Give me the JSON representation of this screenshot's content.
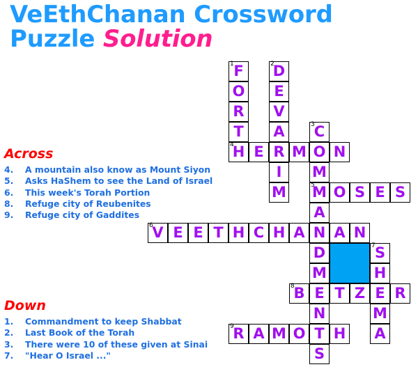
{
  "title": {
    "line1": "VeEthChanan Crossword",
    "line2_main": "Puzzle ",
    "line2_emph": "Solution",
    "color_main": "#1f9bff",
    "color_emph": "#ff1e8e"
  },
  "across": {
    "heading": "Across",
    "heading_color": "#ff0000",
    "clues": [
      {
        "num": "4.",
        "text": "A mountain also know as Mount Siyon"
      },
      {
        "num": "5.",
        "text": "Asks HaShem to see the Land of Israel"
      },
      {
        "num": "6.",
        "text": "This week's Torah Portion"
      },
      {
        "num": "8.",
        "text": "Refuge city of Reubenites"
      },
      {
        "num": "9.",
        "text": "Refuge city of Gaddites"
      }
    ]
  },
  "down": {
    "heading": "Down",
    "heading_color": "#ff0000",
    "clues": [
      {
        "num": "1.",
        "text": "Commandment to keep Shabbat"
      },
      {
        "num": "2.",
        "text": "Last Book of the Torah"
      },
      {
        "num": "3.",
        "text": "There were 10 of these given at Sinai"
      },
      {
        "num": "7.",
        "text": "\"Hear O Israel ...\""
      }
    ]
  },
  "grid": {
    "cell_size": 29,
    "letter_color": "#a110ee",
    "block_color": "#00a2f3",
    "answers": {
      "down_1": "FORTH",
      "down_2": "DEVARIM",
      "down_3": "COMMANDMENTS",
      "down_7": "SHEMA",
      "across_4": "HERMON",
      "across_5": "MOSES",
      "across_6": "VEETHCHANAN",
      "across_8": "BETZER",
      "across_9": "RAMOTH"
    },
    "cells": [
      {
        "r": 0,
        "c": 4,
        "l": "F",
        "n": "1"
      },
      {
        "r": 1,
        "c": 4,
        "l": "O"
      },
      {
        "r": 2,
        "c": 4,
        "l": "R"
      },
      {
        "r": 3,
        "c": 4,
        "l": "T"
      },
      {
        "r": 0,
        "c": 6,
        "l": "D",
        "n": "2"
      },
      {
        "r": 1,
        "c": 6,
        "l": "E"
      },
      {
        "r": 2,
        "c": 6,
        "l": "V"
      },
      {
        "r": 3,
        "c": 6,
        "l": "A"
      },
      {
        "r": 3,
        "c": 8,
        "l": "C",
        "n": "3"
      },
      {
        "r": 4,
        "c": 4,
        "l": "H",
        "n": "4"
      },
      {
        "r": 4,
        "c": 5,
        "l": "E"
      },
      {
        "r": 4,
        "c": 6,
        "l": "R"
      },
      {
        "r": 4,
        "c": 7,
        "l": "M"
      },
      {
        "r": 4,
        "c": 8,
        "l": "O"
      },
      {
        "r": 4,
        "c": 9,
        "l": "N"
      },
      {
        "r": 5,
        "c": 6,
        "l": "I"
      },
      {
        "r": 5,
        "c": 8,
        "l": "M"
      },
      {
        "r": 6,
        "c": 6,
        "l": "M"
      },
      {
        "r": 6,
        "c": 8,
        "l": "M",
        "n": "5"
      },
      {
        "r": 6,
        "c": 9,
        "l": "O"
      },
      {
        "r": 6,
        "c": 10,
        "l": "S"
      },
      {
        "r": 6,
        "c": 11,
        "l": "E"
      },
      {
        "r": 6,
        "c": 12,
        "l": "S"
      },
      {
        "r": 7,
        "c": 8,
        "l": "A"
      },
      {
        "r": 8,
        "c": 0,
        "l": "V",
        "n": "6"
      },
      {
        "r": 8,
        "c": 1,
        "l": "E"
      },
      {
        "r": 8,
        "c": 2,
        "l": "E"
      },
      {
        "r": 8,
        "c": 3,
        "l": "T"
      },
      {
        "r": 8,
        "c": 4,
        "l": "H"
      },
      {
        "r": 8,
        "c": 5,
        "l": "C"
      },
      {
        "r": 8,
        "c": 6,
        "l": "H"
      },
      {
        "r": 8,
        "c": 7,
        "l": "A"
      },
      {
        "r": 8,
        "c": 8,
        "l": "N"
      },
      {
        "r": 8,
        "c": 9,
        "l": "A"
      },
      {
        "r": 8,
        "c": 10,
        "l": "N"
      },
      {
        "r": 9,
        "c": 8,
        "l": "D"
      },
      {
        "r": 9,
        "c": 11,
        "l": "S",
        "n": "7"
      },
      {
        "r": 10,
        "c": 8,
        "l": "M"
      },
      {
        "r": 10,
        "c": 11,
        "l": "H"
      },
      {
        "r": 11,
        "c": 7,
        "l": "B",
        "n": "8"
      },
      {
        "r": 11,
        "c": 8,
        "l": "E"
      },
      {
        "r": 11,
        "c": 9,
        "l": "T"
      },
      {
        "r": 11,
        "c": 10,
        "l": "Z"
      },
      {
        "r": 11,
        "c": 11,
        "l": "E"
      },
      {
        "r": 11,
        "c": 12,
        "l": "R"
      },
      {
        "r": 12,
        "c": 8,
        "l": "N"
      },
      {
        "r": 12,
        "c": 11,
        "l": "M"
      },
      {
        "r": 13,
        "c": 4,
        "l": "R",
        "n": "9"
      },
      {
        "r": 13,
        "c": 5,
        "l": "A"
      },
      {
        "r": 13,
        "c": 6,
        "l": "M"
      },
      {
        "r": 13,
        "c": 7,
        "l": "O"
      },
      {
        "r": 13,
        "c": 8,
        "l": "T"
      },
      {
        "r": 13,
        "c": 9,
        "l": "H"
      },
      {
        "r": 13,
        "c": 11,
        "l": "A"
      },
      {
        "r": 14,
        "c": 8,
        "l": "S"
      }
    ],
    "blocks": [
      {
        "r": 9,
        "c": 9,
        "w": 2,
        "h": 2
      }
    ]
  }
}
